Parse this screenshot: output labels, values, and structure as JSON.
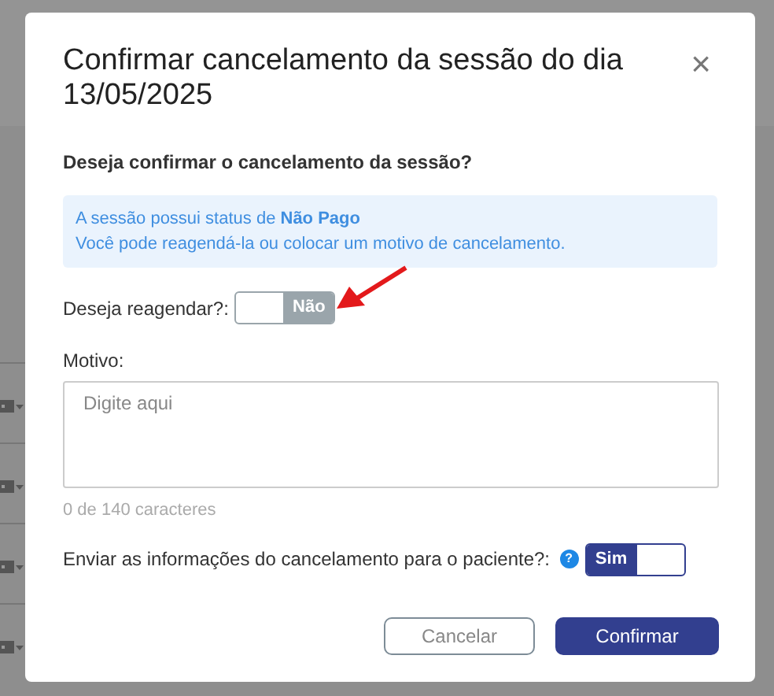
{
  "dialog": {
    "title": "Confirmar cancelamento da sessão do dia 13/05/2025",
    "close": "×",
    "question": "Deseja confirmar o cancelamento da sessão?",
    "info": [
      "A sessão possui status de **Não Pago**",
      "Você pode reagendá-la ou colocar um motivo de cancelamento."
    ],
    "reschedule": {
      "label": "Deseja reagendar?:",
      "toggle": {
        "on": false,
        "text": "Não"
      }
    },
    "reason": {
      "label": "Motivo:",
      "placeholder": "Digite aqui",
      "counter": "0 de 140 caracteres"
    },
    "notify": {
      "label": "Enviar as informações do cancelamento para o paciente?:",
      "help": "?",
      "toggle": {
        "on": true,
        "text": "Sim"
      }
    },
    "buttons": [
      {
        "label": "Cancelar",
        "kind": "secondary"
      },
      {
        "label": "Confirmar",
        "kind": "primary"
      }
    ]
  }
}
